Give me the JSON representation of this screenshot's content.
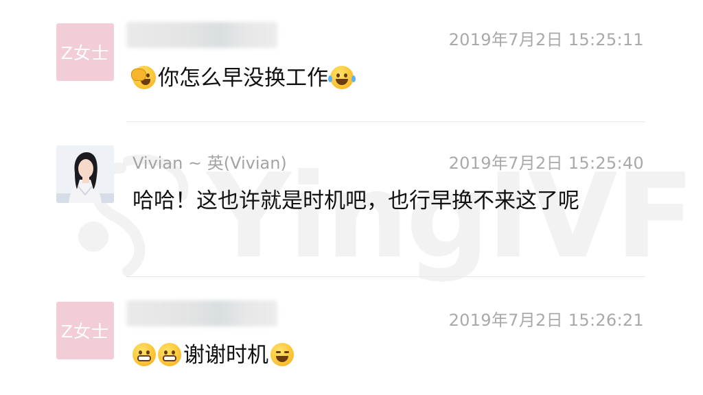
{
  "watermark": {
    "text": "YingIVF"
  },
  "messages": [
    {
      "avatar_text": "Z女士",
      "timestamp": "2019年7月2日  15:25:11",
      "text": "你怎么早没换工作",
      "emojis": [
        "face-palm-emoji",
        "tears-of-joy-emoji"
      ]
    },
    {
      "sender_name": "Vivian ~ 英(Vivian)",
      "timestamp": "2019年7月2日  15:25:40",
      "text": "哈哈！这也许就是时机吧，也行早换不来这了呢"
    },
    {
      "avatar_text": "Z女士",
      "timestamp": "2019年7月2日  15:26:21",
      "text": "谢谢时机",
      "emojis": [
        "grimacing-emoji",
        "grimacing-emoji",
        "squinting-laugh-emoji"
      ]
    }
  ]
}
